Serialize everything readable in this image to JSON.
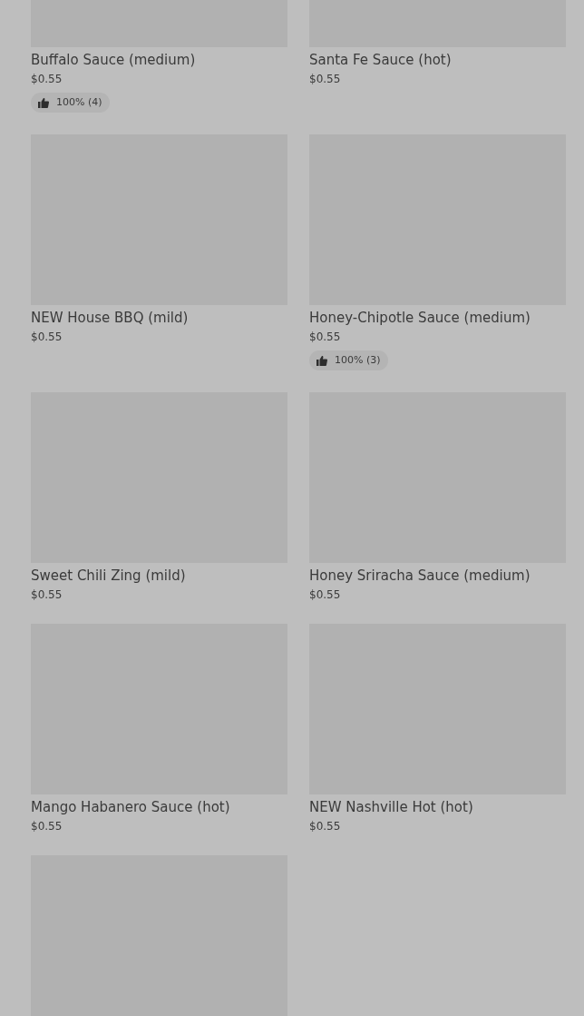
{
  "items": [
    {
      "kind": "placeholder",
      "name": "Buffalo Sauce (medium)",
      "price": "$0.55",
      "rating": "100% (4)"
    },
    {
      "kind": "placeholder",
      "name": "Santa Fe Sauce (hot)",
      "price": "$0.55"
    },
    {
      "kind": "placeholder",
      "name": "NEW House BBQ (mild)",
      "price": "$0.55"
    },
    {
      "kind": "placeholder",
      "name": "Honey-Chipotle Sauce (medium)",
      "price": "$0.55",
      "rating": "100% (3)"
    },
    {
      "kind": "placeholder",
      "name": "Sweet Chili Zing (mild)",
      "price": "$0.55"
    },
    {
      "kind": "placeholder",
      "name": "Honey Sriracha Sauce (medium)",
      "price": "$0.55"
    },
    {
      "kind": "placeholder",
      "name": "Mango Habanero Sauce (hot)",
      "price": "$0.55"
    },
    {
      "kind": "placeholder",
      "name": "NEW Nashville Hot (hot)",
      "price": "$0.55"
    },
    {
      "kind": "placeholder"
    }
  ]
}
